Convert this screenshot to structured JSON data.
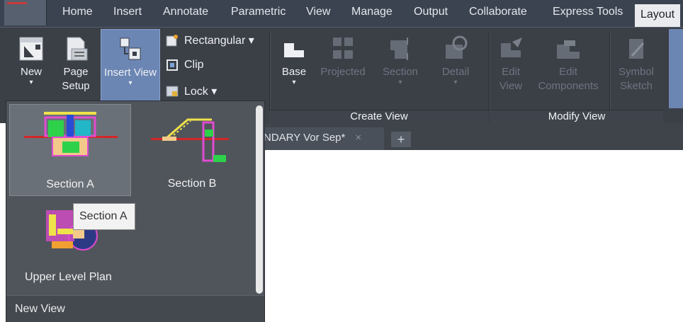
{
  "tabs": [
    "Home",
    "Insert",
    "Annotate",
    "Parametric",
    "View",
    "Manage",
    "Output",
    "Collaborate",
    "Express Tools",
    "Layout"
  ],
  "active_tab": "Layout",
  "ribbon": {
    "new": {
      "line1": "New",
      "caret": "▾"
    },
    "page_setup": {
      "line1": "Page",
      "line2": "Setup"
    },
    "insert_view": {
      "line1": "Insert View",
      "caret": "▾"
    },
    "rectangular": "Rectangular ▾",
    "clip": "Clip",
    "lock": "Lock ▾",
    "base": {
      "line1": "Base",
      "caret": "▾"
    },
    "projected": "Projected",
    "section": {
      "line1": "Section",
      "caret": "▾"
    },
    "detail": {
      "line1": "Detail",
      "caret": "▾"
    },
    "edit_view": {
      "line1": "Edit",
      "line2": "View"
    },
    "edit_components": {
      "line1": "Edit",
      "line2": "Components"
    },
    "symbol_sketch": {
      "line1": "Symbol",
      "line2": "Sketch"
    },
    "panels": {
      "create_view": "Create View",
      "modify_view": "Modify View"
    }
  },
  "document_tab": {
    "title": "NDARY Vor Sep*",
    "close": "×",
    "new_tab": "+"
  },
  "gallery": {
    "items": [
      {
        "label": "Section A"
      },
      {
        "label": "Section B"
      },
      {
        "label": "Upper Level Plan"
      }
    ],
    "footer": "New View",
    "tooltip": "Section A"
  },
  "colors": {
    "accent": "#6c86b4",
    "ribbon": "#3b3f46",
    "gallery": "#50555c"
  }
}
